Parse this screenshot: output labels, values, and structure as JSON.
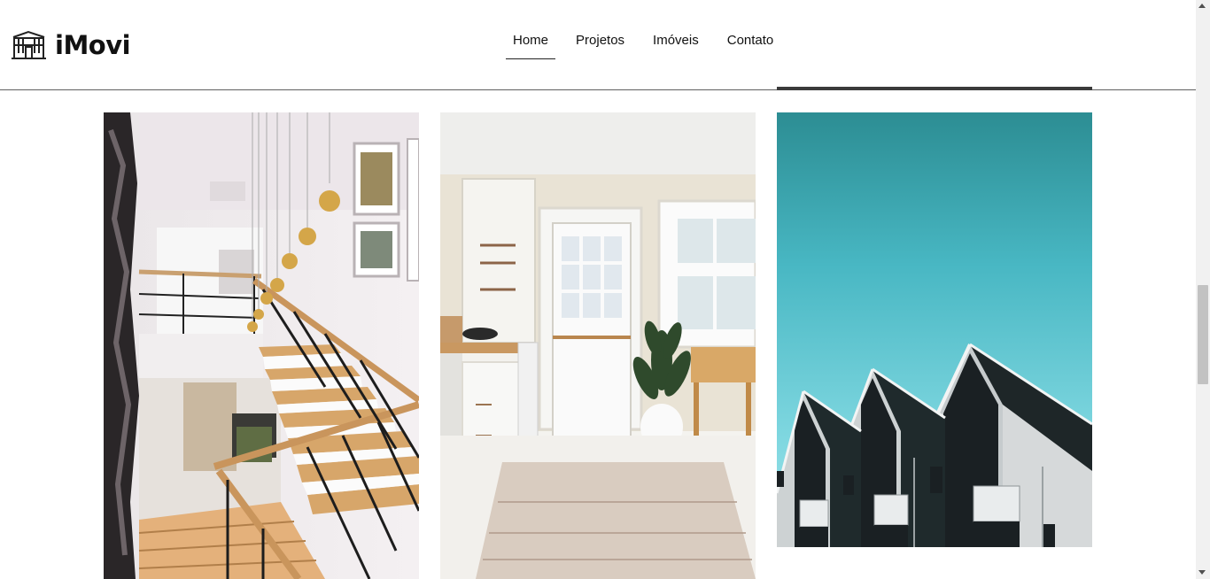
{
  "brand": {
    "name": "iMovi",
    "icon": "house-icon"
  },
  "nav": {
    "items": [
      {
        "label": "Home",
        "active": true
      },
      {
        "label": "Projetos",
        "active": false
      },
      {
        "label": "Imóveis",
        "active": false
      },
      {
        "label": "Contato",
        "active": false
      }
    ]
  },
  "gallery": {
    "photos": [
      {
        "subject": "staircase interior with pendant lights"
      },
      {
        "subject": "white kitchen with door and plant"
      },
      {
        "subject": "row of gabled houses against teal sky"
      }
    ]
  },
  "colors": {
    "text": "#111111",
    "header_border": "#5f5f5f",
    "sky": "#48b7c3"
  }
}
